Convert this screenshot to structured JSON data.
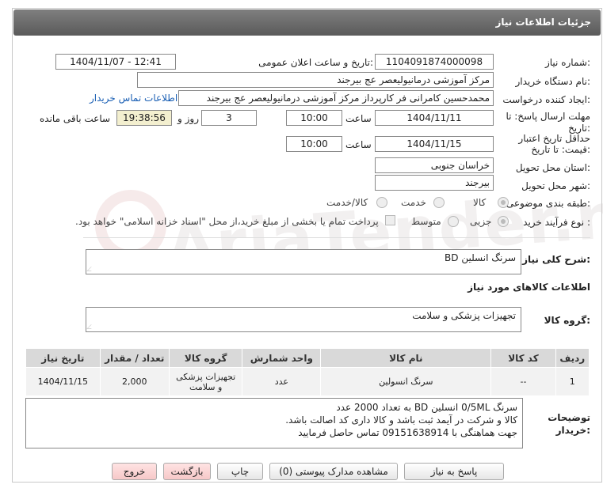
{
  "header": {
    "title": "جزئیات اطلاعات نیاز"
  },
  "form": {
    "need_number_label": "شماره نیاز:",
    "need_number": "1104091874000098",
    "announce_label": "تاریخ و ساعت اعلان عمومی:",
    "announce_value": "1404/11/07 - 12:41",
    "buyer_org_label": "نام دستگاه خریدار:",
    "buyer_org": "مرکز آموزشی درمانیولیعصر  عج  بیرجند",
    "requester_label": "ایجاد کننده درخواست:",
    "requester": "محمدحسین کامرانی فر کارپرداز مرکز آموزشی درمانیولیعصر  عج  بیرجند",
    "contact_link": "اطلاعات تماس خریدار",
    "deadline_label_1": "مهلت ارسال پاسخ: تا",
    "deadline_label_2": "تاریخ:",
    "deadline_date": "1404/11/11",
    "time_label": "ساعت",
    "deadline_time": "10:00",
    "days_value": "3",
    "days_label": "روز و",
    "remaining_time": "19:38:56",
    "remaining_label": "ساعت باقی مانده",
    "validity_label_1": "حداقل تاریخ اعتبار",
    "validity_label_2": "قیمت: تا تاریخ:",
    "validity_date": "1404/11/15",
    "validity_time": "10:00",
    "province_label": "استان محل تحویل:",
    "province": "خراسان جنوبی",
    "city_label": "شهر محل تحویل:",
    "city": "بیرجند",
    "category_label": "طبقه بندی موضوعی:",
    "category_options": [
      "کالا",
      "خدمت",
      "کالا/خدمت"
    ],
    "process_label": "نوع فرآیند خرید :",
    "process_options": [
      "جزیی",
      "متوسط"
    ],
    "payment_note": "پرداخت تمام یا بخشی از مبلغ خرید،از محل \"اسناد خزانه اسلامی\" خواهد بود."
  },
  "summary": {
    "label": "شرح کلی نیاز:",
    "value": "سرنگ انسلین BD"
  },
  "goods_info": {
    "title": "اطلاعات کالاهای مورد نیاز",
    "group_label": "گروه کالا:",
    "group_value": "تجهیزات پزشکی و سلامت"
  },
  "table": {
    "headers": [
      "ردیف",
      "کد کالا",
      "نام کالا",
      "واحد شمارش",
      "گروه کالا",
      "تعداد / مقدار",
      "تاریخ نیاز"
    ],
    "rows": [
      [
        "1",
        "--",
        "سرنگ انسولین",
        "عدد",
        "تجهیزات پزشکی و سلامت",
        "2,000",
        "1404/11/15"
      ]
    ]
  },
  "buyer_notes": {
    "label_1": "توضیحات",
    "label_2": "خریدار:",
    "lines": [
      "سرنگ 0/5ML انسلین BD به تعداد 2000 عدد",
      "کالا و شرکت در آیمد ثبت باشد و کالا داری کد اصالت باشد.",
      "جهت هماهنگی با   09151638914  تماس حاصل فرمایید"
    ]
  },
  "buttons": {
    "reply": "پاسخ به نیاز",
    "docs": "مشاهده مدارک پیوستی (0)",
    "print": "چاپ",
    "back": "بازگشت",
    "exit": "خروج"
  },
  "watermark": "AriaTender.net",
  "colors": {
    "header": "#6b6b6b",
    "highlight": "#f3efcf",
    "link": "#1a5fb4",
    "table_header": "#d9d9d9"
  }
}
